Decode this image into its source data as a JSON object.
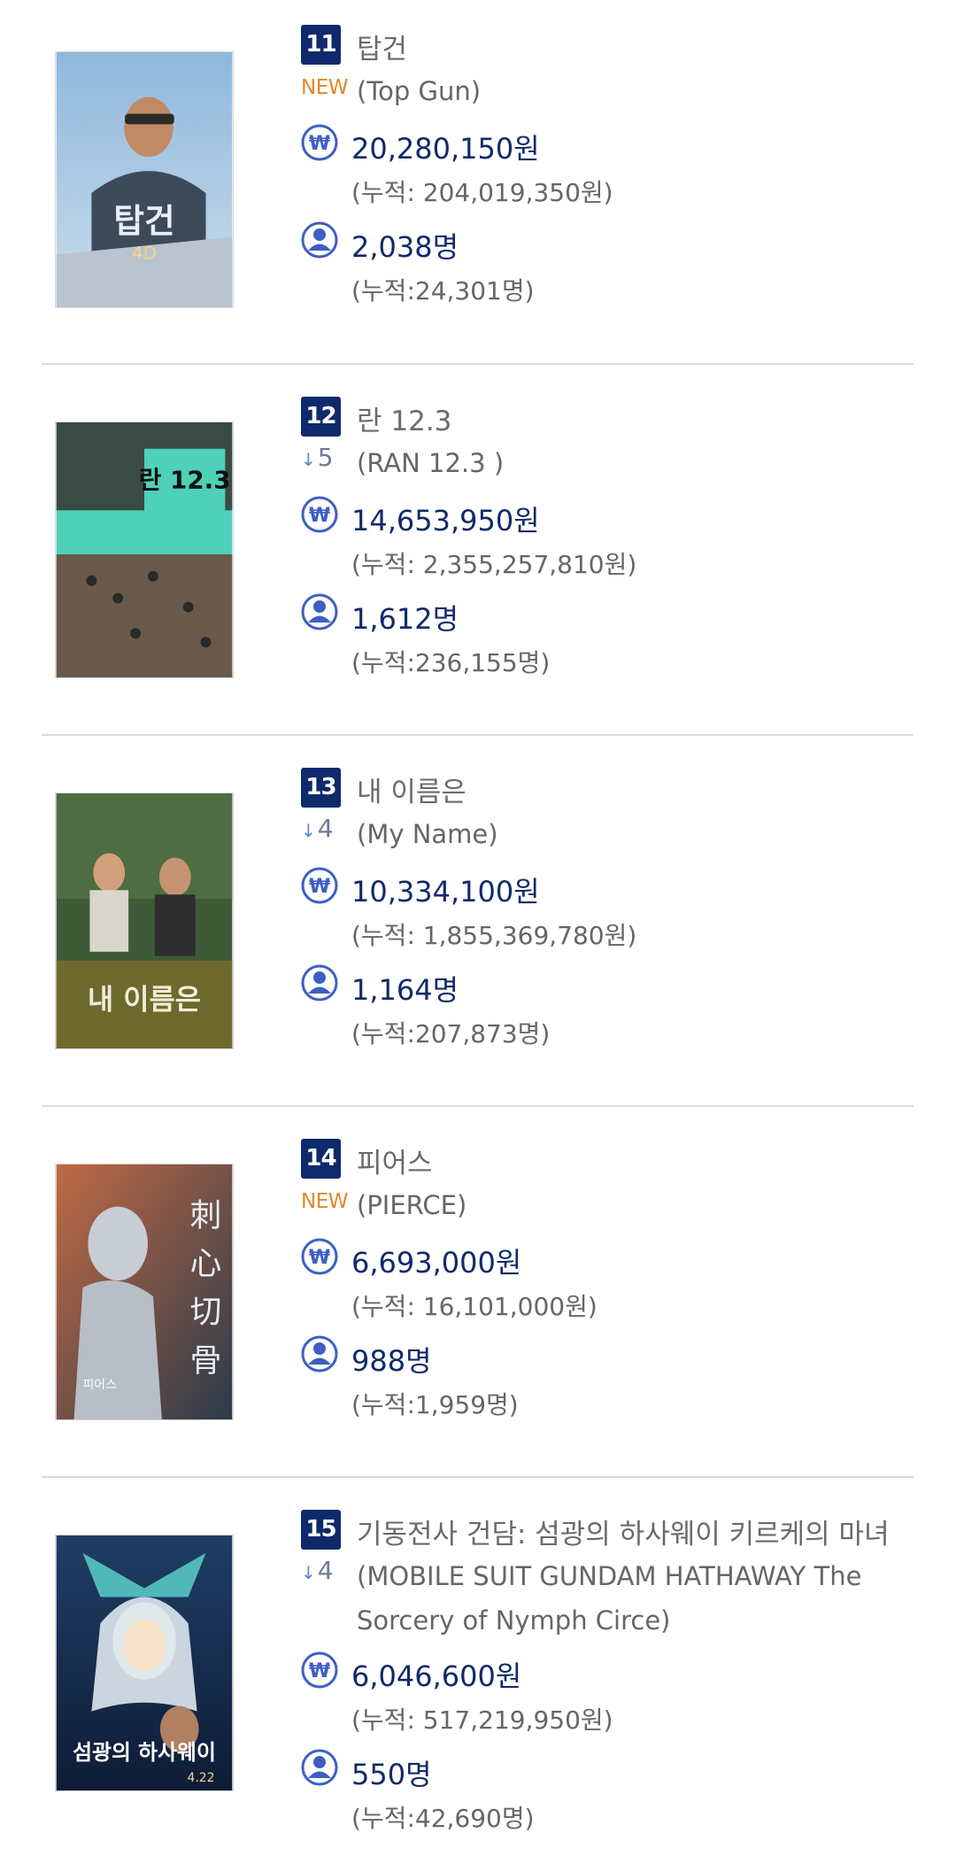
{
  "movies": [
    {
      "rank": "11",
      "title": "탑건",
      "badge_type": "new",
      "badge_text": "NEW",
      "original_title": "(Top Gun)",
      "revenue": "20,280,150원",
      "revenue_cumulative": "(누적: 204,019,350원)",
      "audience": "2,038명",
      "audience_cumulative": "(누적:24,301명)",
      "poster_text": "탑건"
    },
    {
      "rank": "12",
      "title": "란 12.3",
      "badge_type": "down",
      "badge_text": "5",
      "original_title": "(RAN 12.3 )",
      "revenue": "14,653,950원",
      "revenue_cumulative": "(누적: 2,355,257,810원)",
      "audience": "1,612명",
      "audience_cumulative": "(누적:236,155명)",
      "poster_text": "란 12.3"
    },
    {
      "rank": "13",
      "title": "내 이름은",
      "badge_type": "down",
      "badge_text": "4",
      "original_title": "(My Name)",
      "revenue": "10,334,100원",
      "revenue_cumulative": "(누적: 1,855,369,780원)",
      "audience": "1,164명",
      "audience_cumulative": "(누적:207,873명)",
      "poster_text": "내 이름은"
    },
    {
      "rank": "14",
      "title": "피어스",
      "badge_type": "new",
      "badge_text": "NEW",
      "original_title": "(PIERCE)",
      "revenue": "6,693,000원",
      "revenue_cumulative": "(누적: 16,101,000원)",
      "audience": "988명",
      "audience_cumulative": "(누적:1,959명)",
      "poster_text": "刺心切骨"
    },
    {
      "rank": "15",
      "title": "기동전사 건담: 섬광의 하사웨이 키르케의 마녀",
      "badge_type": "down",
      "badge_text": "4",
      "original_title": "(MOBILE SUIT GUNDAM HATHAWAY The Sorcery of Nymph Circe)",
      "revenue": "6,046,600원",
      "revenue_cumulative": "(누적: 517,219,950원)",
      "audience": "550명",
      "audience_cumulative": "(누적:42,690명)",
      "poster_text": "섬광의 하사웨이"
    }
  ],
  "icons": {
    "won": "won-circle-icon",
    "person": "person-circle-icon",
    "down": "down-arrow-icon"
  },
  "colors": {
    "rank_bg": "#0e2a6b",
    "new_badge": "#e0892a",
    "icon_blue": "#3d5fc4",
    "value_text": "#102a6a"
  }
}
